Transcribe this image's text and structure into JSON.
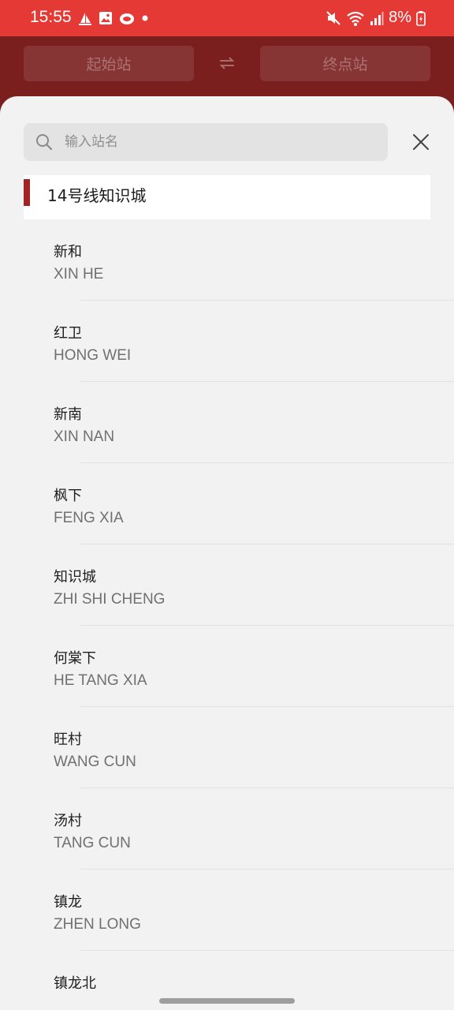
{
  "status_bar": {
    "time": "15:55",
    "battery": "8%",
    "colors": {
      "background": "#e53935"
    }
  },
  "header": {
    "start_station_placeholder": "起始站",
    "end_station_placeholder": "终点站"
  },
  "search": {
    "placeholder": "输入站名",
    "value": ""
  },
  "line": {
    "title": "14号线知识城",
    "accent_color": "#a32424"
  },
  "stations": [
    {
      "name": "新和",
      "pinyin": "XIN HE"
    },
    {
      "name": "红卫",
      "pinyin": "HONG WEI"
    },
    {
      "name": "新南",
      "pinyin": "XIN NAN"
    },
    {
      "name": "枫下",
      "pinyin": "FENG XIA"
    },
    {
      "name": "知识城",
      "pinyin": "ZHI SHI CHENG"
    },
    {
      "name": "何棠下",
      "pinyin": "HE TANG XIA"
    },
    {
      "name": "旺村",
      "pinyin": "WANG CUN"
    },
    {
      "name": "汤村",
      "pinyin": "TANG CUN"
    },
    {
      "name": "镇龙",
      "pinyin": "ZHEN LONG"
    },
    {
      "name": "镇龙北",
      "pinyin": ""
    }
  ],
  "icons": {
    "search": "search-icon",
    "close": "close-icon",
    "swap": "swap-icon"
  }
}
